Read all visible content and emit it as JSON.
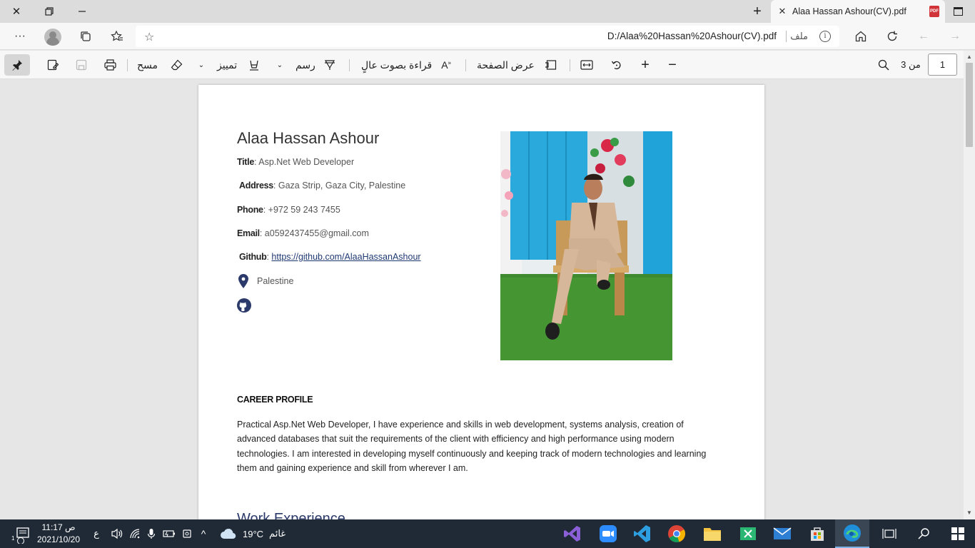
{
  "browser": {
    "tab_title": "Alaa Hassan Ashour(CV).pdf",
    "pdf_badge": "PDF",
    "url": "D:/Alaa%20Hassan%20Ashour(CV).pdf",
    "file_label": "ملف"
  },
  "pdf_toolbar": {
    "erase_label": "مسح",
    "highlight_label": "تمييز",
    "draw_label": "رسم",
    "read_aloud_label": "قراءة بصوت عالٍ",
    "page_view_label": "عرض الصفحة",
    "page_of_label": "من 3",
    "page_number": "1"
  },
  "cv": {
    "name": "Alaa Hassan Ashour",
    "title_label": "Title",
    "title_value": ": Asp.Net Web Developer",
    "address_label": "Address",
    "address_value": ": Gaza Strip, Gaza City, Palestine",
    "phone_label": "Phone",
    "phone_value": ": +972 59 243 7455",
    "email_label": "Email",
    "email_value": ": a0592437455@gmail.com",
    "github_label": "Github",
    "github_sep": ": ",
    "github_link": "https://github.com/AlaaHassanAshour",
    "location": "Palestine",
    "career_heading": "CAREER PROFILE",
    "career_text": "Practical Asp.Net Web Developer, I have experience and skills in web development, systems analysis, creation of advanced databases that suit the requirements of the client with efficiency and high performance using modern technologies. I am interested in developing myself continuously and keeping track of modern technologies and learning them and gaining experience and skill from wherever I am.",
    "work_heading": "Work Experience"
  },
  "taskbar": {
    "time": "11:17 ص",
    "date": "2021/10/20",
    "lang": "ع",
    "weather_temp": "19°C",
    "weather_desc": "غائم",
    "notification_count": "1"
  },
  "colors": {
    "accent": "#1f3a73",
    "taskbar_bg": "#1f2a36",
    "pdf_red": "#d13438"
  }
}
